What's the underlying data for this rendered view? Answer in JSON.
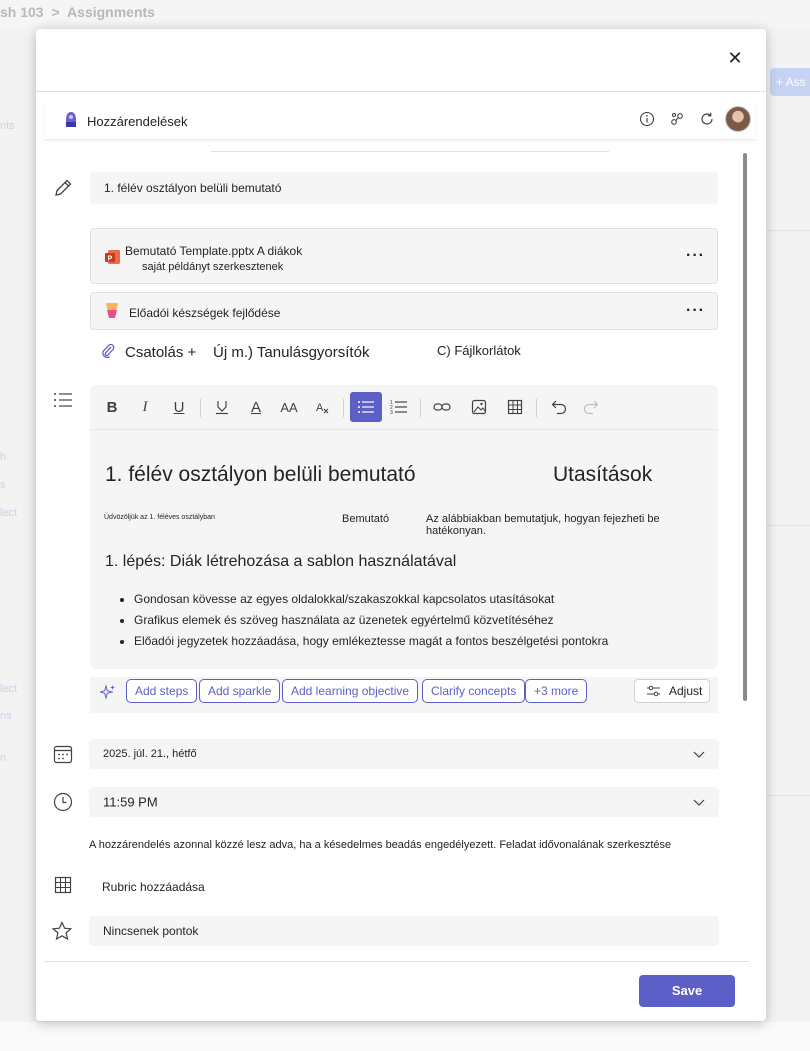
{
  "background": {
    "breadcrumb": [
      "sh 103",
      ">",
      "Assignments"
    ],
    "assign_button": "+ Ass",
    "left_snippets": [
      "nts",
      "h",
      "s",
      "lect",
      "lect",
      "ns",
      "n"
    ]
  },
  "modal": {
    "close_icon": "close-icon",
    "header": {
      "app_title": "Hozzárendelések",
      "icons": [
        "info-icon",
        "share-icon",
        "refresh-icon"
      ]
    },
    "title_field": {
      "value": "1. félév osztályon belüli bemutató"
    },
    "attachments": [
      {
        "icon": "powerpoint-icon",
        "line1": "Bemutató Template.pptx A diákok",
        "line2": "saját példányt szerkesztenek",
        "more": "···"
      },
      {
        "icon": "reading-progress-icon",
        "line1": "Előadói készségek fejlődése",
        "more": "···"
      }
    ],
    "attach_row": {
      "attach": "Csatolás +",
      "new": "Új m.) Tanulásgyorsítók",
      "limits": "C) Fájlkorlátok"
    },
    "editor": {
      "toolbar": [
        "bold",
        "italic",
        "underline",
        "highlight",
        "font-color",
        "font-size",
        "clear-format",
        "bullet-list",
        "numbered-list",
        "link",
        "image",
        "table",
        "undo",
        "redo"
      ],
      "bold": "B",
      "italic": "I",
      "underline": "U",
      "font_color": "A",
      "font_size": "AA",
      "title_left": "1. félév osztályon belüli bemutató",
      "title_right": "Utasítások",
      "sub_welcome": "Üdvözöljük az 1. féléves osztályban",
      "sub_presentation": "Bemutató",
      "sub_desc": "Az alábbiakban bemutatjuk, hogyan fejezheti be hatékonyan.",
      "step_heading": "1. lépés: Diák létrehozása a sablon használatával",
      "bullets": [
        "Gondosan kövesse az egyes oldalokkal/szakaszokkal kapcsolatos utasításokat",
        "Grafikus elemek és szöveg használata az üzenetek egyértelmű közvetítéséhez",
        "Előadói jegyzetek hozzáadása, hogy emlékeztesse magát a fontos beszélgetési pontokra"
      ]
    },
    "ai_chips": [
      "Add steps",
      "Add sparkle",
      "Add learning objective",
      "Clarify concepts",
      "+3 more"
    ],
    "adjust": "Adjust",
    "due_date": "2025. júl. 21., hétfő",
    "due_time": "11:59 PM",
    "note": "A hozzárendelés azonnal közzé lesz adva, ha a késedelmes beadás engedélyezett. Feladat idővonalának szerkesztése",
    "rubric": "Rubric hozzáadása",
    "points": "Nincsenek pontok",
    "save": "Save",
    "colors": {
      "accent": "#5b5fc7",
      "field_bg": "#f5f5f5"
    }
  }
}
